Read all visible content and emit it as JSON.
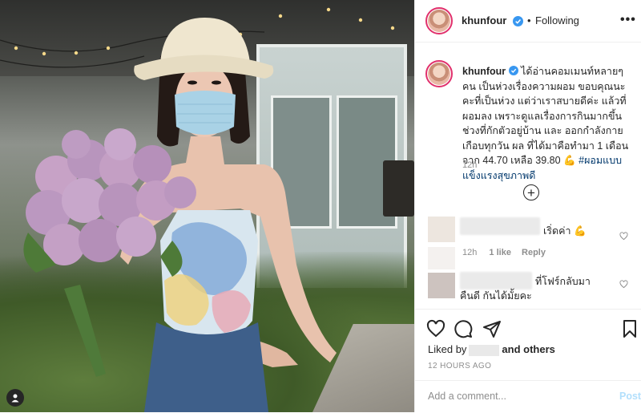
{
  "post": {
    "username": "khunfour",
    "follow_sep": "•",
    "follow_status": "Following",
    "more_icon": "more-horizontal-icon",
    "caption": "ได้อ่านคอมเมนท์หลายๆคน เป็นห่วงเรื่องความผอม ขอบคุณนะคะที่เป็นห่วง แต่ว่าเราสบายดีค่ะ แล้วที่ผอมลง เพราะดูแลเรื่องการกินมากขึ้นช่วงที่กักตัวอยู่บ้าน และ ออกกำลังกายเกือบทุกวัน ผล ที่ได้มาคือทำมา 1 เดือน จาก 44.70 เหลือ 39.80",
    "caption_emoji": "💪",
    "hashtag": "#ผอมแบบแข็งแรงสุขภาพดี",
    "caption_time": "12h"
  },
  "comments": [
    {
      "text": "เริ่ดค่า",
      "emoji": "💪",
      "time": "12h",
      "likes": "1 like",
      "reply": "Reply"
    },
    {
      "text": "ที่โฟร์กลับมาคืนดี กันได้มั้ยคะ"
    }
  ],
  "footer": {
    "liked_by": "Liked by",
    "and_others": "and others",
    "ago": "12 HOURS AGO",
    "add_comment_placeholder": "Add a comment...",
    "post_label": "Post"
  },
  "colors": {
    "accent": "#0095f6",
    "story_ring": "#e1306c",
    "hashtag": "#00376b"
  }
}
